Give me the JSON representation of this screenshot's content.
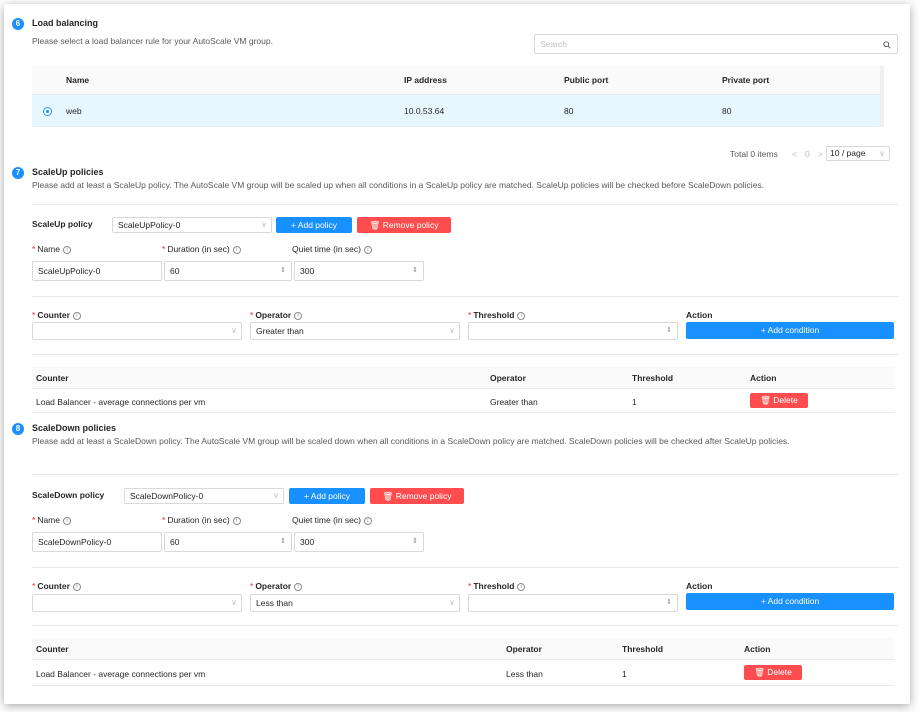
{
  "load_balancing": {
    "step": "6",
    "title": "Load balancing",
    "description": "Please select a load balancer rule for your AutoScale VM group.",
    "search_placeholder": "Search",
    "columns": [
      "Name",
      "IP address",
      "Public port",
      "Private port"
    ],
    "rows": [
      {
        "name": "web",
        "ip": "10.0.53.64",
        "public_port": "80",
        "private_port": "80",
        "selected": true
      }
    ],
    "pagination": {
      "total": "Total 0 items",
      "prev": "<",
      "page": "0",
      "next": ">",
      "page_size": "10 / page"
    }
  },
  "scaleup": {
    "step": "7",
    "title": "ScaleUp policies",
    "description": "Please add at least a ScaleUp policy. The AutoScale VM group will be scaled up when all conditions in a ScaleUp policy are matched. ScaleUp policies will be checked before ScaleDown policies.",
    "policy_label": "ScaleUp policy",
    "policy_selected": "ScaleUpPolicy-0",
    "add_policy": "+ Add policy",
    "remove_policy": "Remove policy",
    "name_label": "Name",
    "name_value": "ScaleUpPolicy-0",
    "duration_label": "Duration (in sec)",
    "duration_value": "60",
    "quiet_label": "Quiet time (in sec)",
    "quiet_value": "300",
    "counter_label": "Counter",
    "counter_value": "",
    "operator_label": "Operator",
    "operator_value": "Greater than",
    "threshold_label": "Threshold",
    "threshold_value": "",
    "action_label": "Action",
    "add_condition": "+ Add condition",
    "columns": [
      "Counter",
      "Operator",
      "Threshold",
      "Action"
    ],
    "conditions": [
      {
        "counter": "Load Balancer - average connections per vm",
        "operator": "Greater than",
        "threshold": "1",
        "action": "Delete"
      }
    ]
  },
  "scaledown": {
    "step": "8",
    "title": "ScaleDown policies",
    "description": "Please add at least a ScaleDown policy. The AutoScale VM group will be scaled down when all conditions in a ScaleDown policy are matched. ScaleDown policies will be checked after ScaleUp policies.",
    "policy_label": "ScaleDown policy",
    "policy_selected": "ScaleDownPolicy-0",
    "add_policy": "+ Add policy",
    "remove_policy": "Remove policy",
    "name_label": "Name",
    "name_value": "ScaleDownPolicy-0",
    "duration_label": "Duration (in sec)",
    "duration_value": "60",
    "quiet_label": "Quiet time (in sec)",
    "quiet_value": "300",
    "counter_label": "Counter",
    "counter_value": "",
    "operator_label": "Operator",
    "operator_value": "Less than",
    "threshold_label": "Threshold",
    "threshold_value": "",
    "action_label": "Action",
    "add_condition": "+ Add condition",
    "columns": [
      "Counter",
      "Operator",
      "Threshold",
      "Action"
    ],
    "conditions": [
      {
        "counter": "Load Balancer - average connections per vm",
        "operator": "Less than",
        "threshold": "1",
        "action": "Delete"
      }
    ]
  },
  "colors": {
    "primary": "#1890ff",
    "danger": "#ff4d4f",
    "selected_row": "#e6f7ff"
  }
}
